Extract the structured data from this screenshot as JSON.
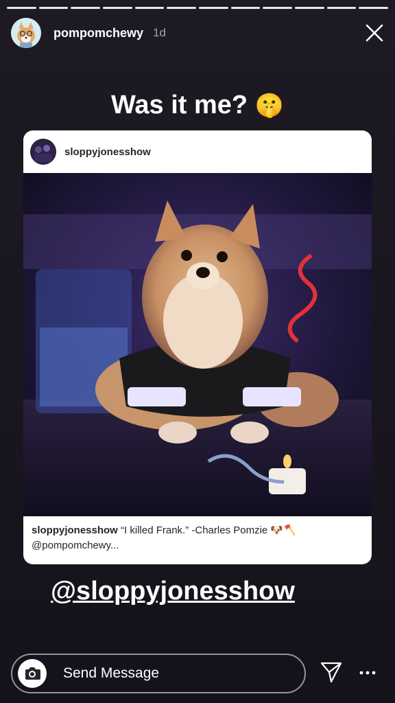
{
  "story": {
    "progress_segments": 12,
    "segments_viewed": 11,
    "username": "pompomchewy",
    "time_ago": "1d"
  },
  "caption": {
    "text": "Was it me?",
    "emoji": "🤫"
  },
  "shared_post": {
    "username": "sloppyjonesshow",
    "caption_user": "sloppyjonesshow",
    "caption_text": "“I killed Frank.” -Charles Pomzie 🐶🪓",
    "caption_more": "@pompomchewy..."
  },
  "mention": "@sloppyjonesshow",
  "message_bar": {
    "placeholder": "Send Message"
  },
  "icons": [
    "close-icon",
    "camera-icon",
    "send-icon",
    "more-icon"
  ],
  "colors": {
    "background": "#1a1720",
    "card_bg": "#ffffff",
    "card_text": "#262626"
  }
}
